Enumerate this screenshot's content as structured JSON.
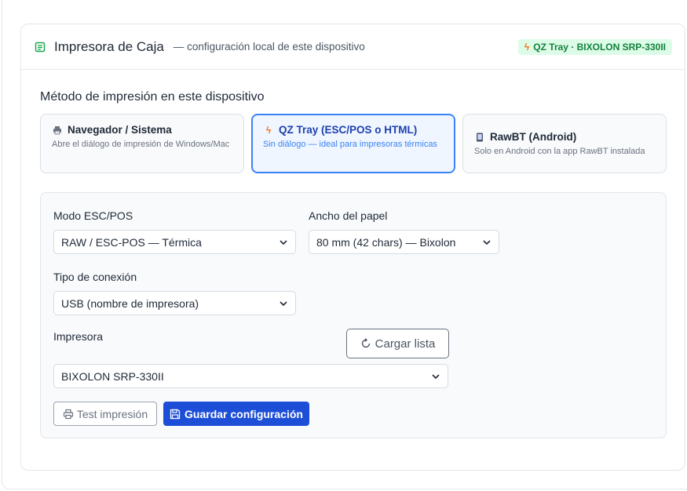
{
  "header": {
    "title": "Impresora de Caja",
    "subtitle": "— configuración local de este dispositivo",
    "status_badge": "QZ Tray · BIXOLON SRP-330II"
  },
  "method_section": {
    "title": "Método de impresión en este dispositivo",
    "options": [
      {
        "title": "Navegador / Sistema",
        "desc": "Abre el diálogo de impresión de Windows/Mac",
        "icon": "printer-icon",
        "selected": false
      },
      {
        "title": "QZ Tray (ESC/POS o HTML)",
        "desc": "Sin diálogo — ideal para impresoras térmicas",
        "icon": "bolt-icon",
        "selected": true
      },
      {
        "title": "RawBT (Android)",
        "desc": "Solo en Android con la app RawBT instalada",
        "icon": "phone-icon",
        "selected": false
      }
    ]
  },
  "config": {
    "escpos_mode": {
      "label": "Modo ESC/POS",
      "value": "RAW / ESC-POS — Térmica"
    },
    "paper_width": {
      "label": "Ancho del papel",
      "value": "80 mm (42 chars) — Bixolon"
    },
    "connection_type": {
      "label": "Tipo de conexión",
      "value": "USB (nombre de impresora)"
    },
    "printer": {
      "label": "Impresora",
      "value": "BIXOLON SRP-330II"
    },
    "reload_label": "Cargar lista",
    "test_label": "Test impresión",
    "save_label": "Guardar configuración"
  },
  "colors": {
    "accent": "#1d4ed8",
    "selected_border": "#3b82f6",
    "badge_bg": "#dcfce7",
    "badge_text": "#15803d"
  }
}
